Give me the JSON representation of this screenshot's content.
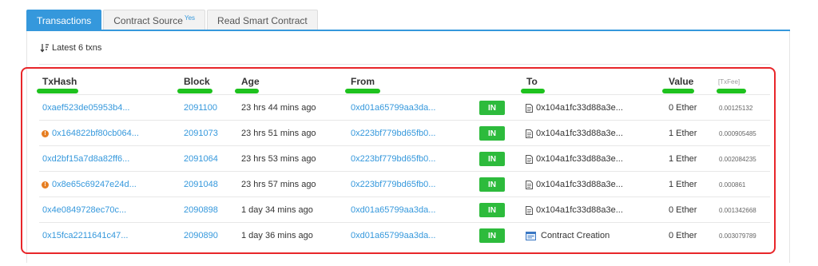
{
  "tabs": [
    {
      "label": "Transactions",
      "active": true
    },
    {
      "label": "Contract Source",
      "badge": "Yes"
    },
    {
      "label": "Read Smart Contract"
    }
  ],
  "summary": "Latest 6 txns",
  "columns": {
    "txhash": "TxHash",
    "block": "Block",
    "age": "Age",
    "from": "From",
    "to": "To",
    "value": "Value",
    "txfee": "[TxFee]"
  },
  "rows": [
    {
      "txhash": "0xaef523de05953b4...",
      "error": false,
      "block": "2091100",
      "age": "23 hrs 44 mins ago",
      "from": "0xd01a65799aa3da...",
      "direction": "IN",
      "to": "0x104a1fc33d88a3e...",
      "to_type": "contract",
      "value": "0 Ether",
      "fee": "0.00125132"
    },
    {
      "txhash": "0x164822bf80cb064...",
      "error": true,
      "block": "2091073",
      "age": "23 hrs 51 mins ago",
      "from": "0x223bf779bd65fb0...",
      "direction": "IN",
      "to": "0x104a1fc33d88a3e...",
      "to_type": "contract",
      "value": "1 Ether",
      "fee": "0.000905485"
    },
    {
      "txhash": "0xd2bf15a7d8a82ff6...",
      "error": false,
      "block": "2091064",
      "age": "23 hrs 53 mins ago",
      "from": "0x223bf779bd65fb0...",
      "direction": "IN",
      "to": "0x104a1fc33d88a3e...",
      "to_type": "contract",
      "value": "1 Ether",
      "fee": "0.002084235"
    },
    {
      "txhash": "0x8e65c69247e24d...",
      "error": true,
      "block": "2091048",
      "age": "23 hrs 57 mins ago",
      "from": "0x223bf779bd65fb0...",
      "direction": "IN",
      "to": "0x104a1fc33d88a3e...",
      "to_type": "contract",
      "value": "1 Ether",
      "fee": "0.000861"
    },
    {
      "txhash": "0x4e0849728ec70c...",
      "error": false,
      "block": "2090898",
      "age": "1 day 34 mins ago",
      "from": "0xd01a65799aa3da...",
      "direction": "IN",
      "to": "0x104a1fc33d88a3e...",
      "to_type": "contract",
      "value": "0 Ether",
      "fee": "0.001342668"
    },
    {
      "txhash": "0x15fca2211641c47...",
      "error": false,
      "block": "2090890",
      "age": "1 day 36 mins ago",
      "from": "0xd01a65799aa3da...",
      "direction": "IN",
      "to": "Contract Creation",
      "to_type": "creation",
      "value": "0 Ether",
      "fee": "0.003079789"
    }
  ],
  "colors": {
    "accent": "#3598dc",
    "in_badge": "#2dbb3c",
    "highlight_underline": "#1ec21e",
    "annotation_box": "#e8262a",
    "error_icon": "#e67e22"
  }
}
